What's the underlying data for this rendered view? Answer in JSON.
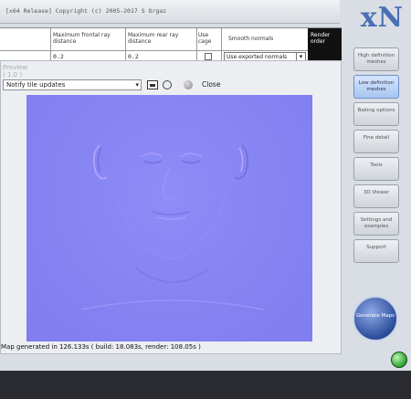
{
  "titlebar": {
    "text": "[x64 Release] Copyright (c) 2005-2017 S Orgaz"
  },
  "logo": "xN",
  "grid": {
    "headers": {
      "front": "Maximum frontal ray distance",
      "rear": "Maximum rear ray distance",
      "cage": "Use cage",
      "smooth": "Smooth normals",
      "render_order": "Render order"
    },
    "values": {
      "front": "0.2",
      "rear": "0.2",
      "smooth": "Use exported normals"
    }
  },
  "preview": {
    "title": "Preview ( 1.0 )",
    "notify_select": "Notify tile updates",
    "close_label": "Close",
    "status": "Map generated in 126.133s ( build: 18.083s, render: 108.05s )"
  },
  "side_menu": [
    {
      "label": "High definition meshes",
      "active": false
    },
    {
      "label": "Low definition meshes",
      "active": true
    },
    {
      "label": "Baking options",
      "active": false
    },
    {
      "label": "Fine detail",
      "active": false
    },
    {
      "label": "Tools",
      "active": false
    },
    {
      "label": "3D Viewer",
      "active": false
    },
    {
      "label": "Settings and examples",
      "active": false
    },
    {
      "label": "Support",
      "active": false
    }
  ],
  "generate_label": "Generate Maps",
  "colors": {
    "normal_map": "#8583f2",
    "accent": "#4a6fb4",
    "active_button": "#a8c6f0"
  }
}
